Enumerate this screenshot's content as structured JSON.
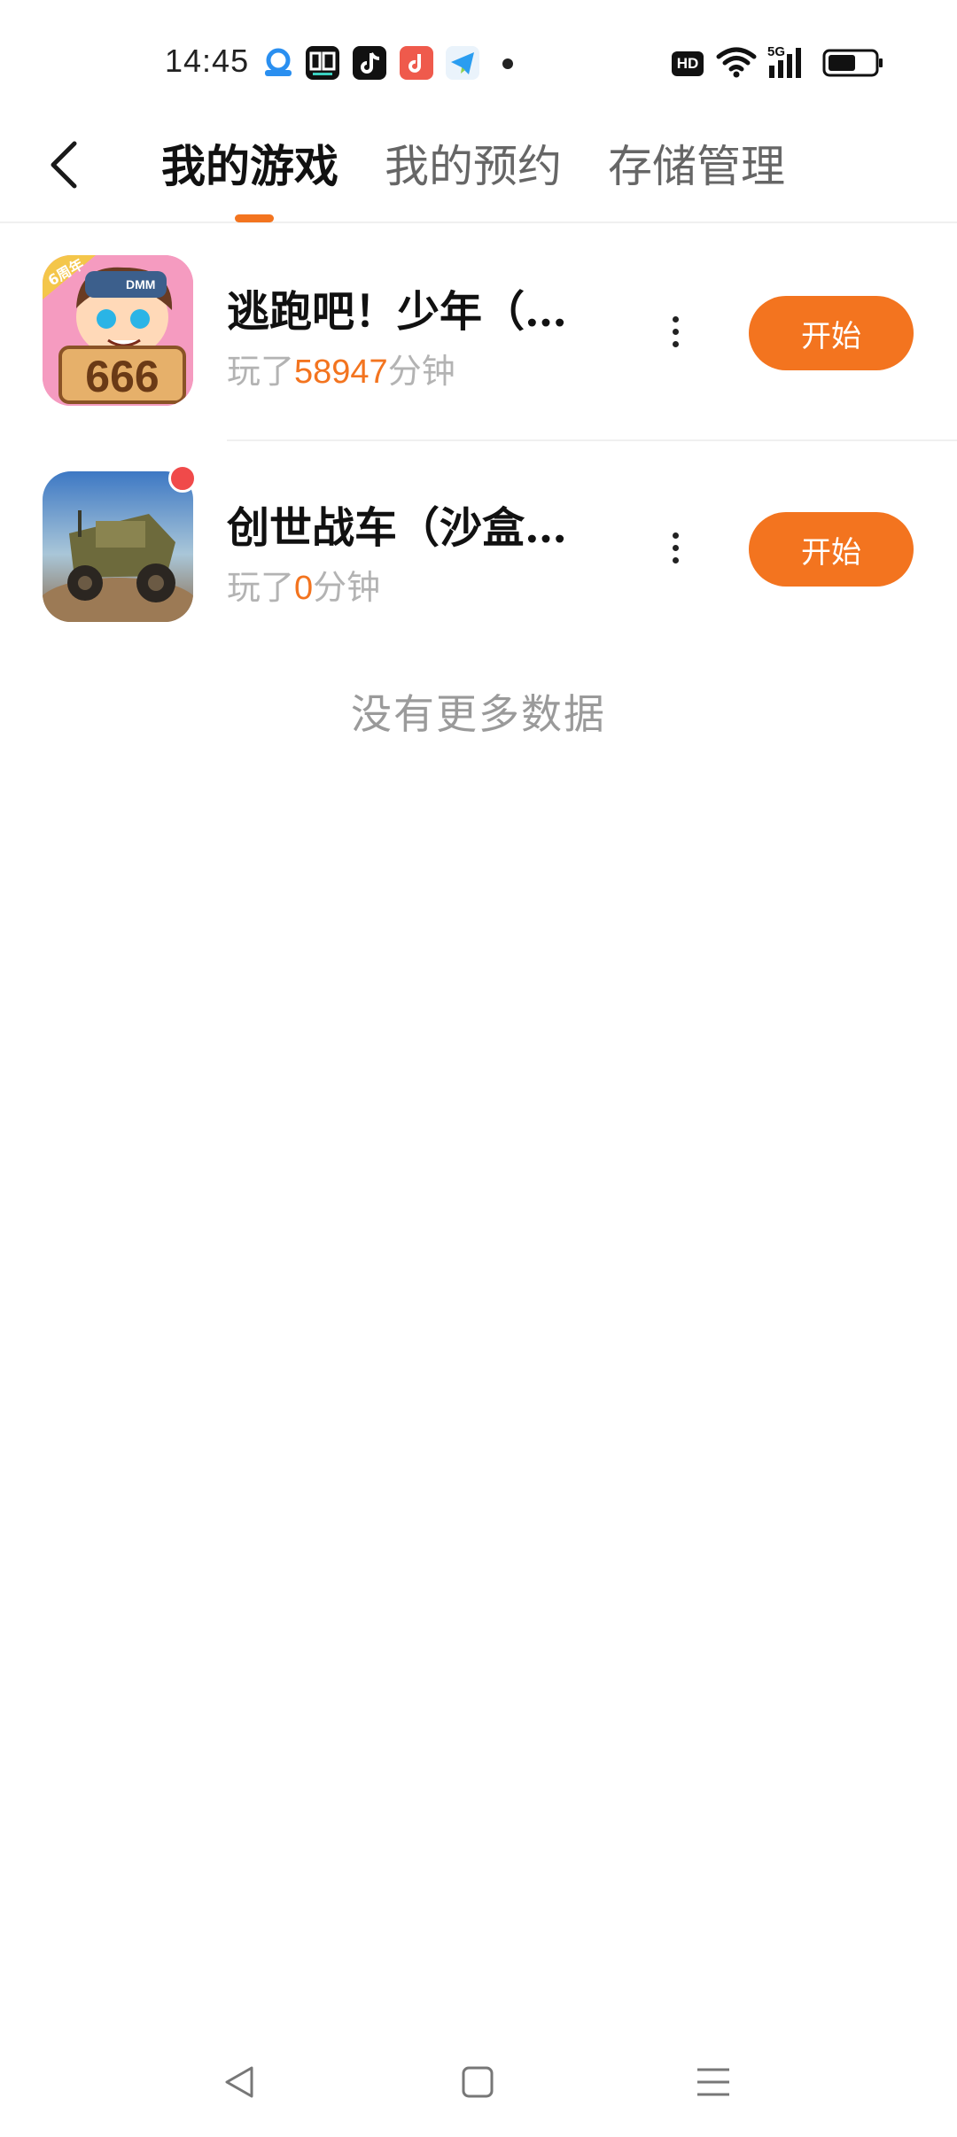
{
  "status_bar": {
    "time": "14:45",
    "notification_icons": [
      "cloud-app-icon",
      "dewu-app-icon",
      "tiktok-icon",
      "music-icon",
      "telegram-icon"
    ],
    "system_icons": [
      "hd-icon",
      "wifi-icon",
      "signal-5g-icon",
      "battery-icon"
    ],
    "hd_label": "HD",
    "network_label": "5G"
  },
  "header": {
    "back_icon": "chevron-left-icon",
    "tabs": [
      {
        "label": "我的游戏",
        "active": true
      },
      {
        "label": "我的预约",
        "active": false
      },
      {
        "label": "存储管理",
        "active": false
      }
    ]
  },
  "games": [
    {
      "title": "逃跑吧！少年（…",
      "played_prefix": "玩了",
      "played_minutes": "58947",
      "played_suffix": "分钟",
      "start_label": "开始",
      "icon_badge": "6周年",
      "icon_text": "666",
      "icon_brand": "DMM",
      "has_red_dot": false
    },
    {
      "title": "创世战车（沙盒…",
      "played_prefix": "玩了",
      "played_minutes": "0",
      "played_suffix": "分钟",
      "start_label": "开始",
      "has_red_dot": true
    }
  ],
  "footer": {
    "no_more_text": "没有更多数据"
  },
  "colors": {
    "accent": "#f3741f",
    "red_dot": "#f04a4a",
    "muted_text": "#b3b3b3"
  },
  "nav": {
    "icons": [
      "back-triangle-icon",
      "home-square-icon",
      "menu-lines-icon"
    ]
  }
}
